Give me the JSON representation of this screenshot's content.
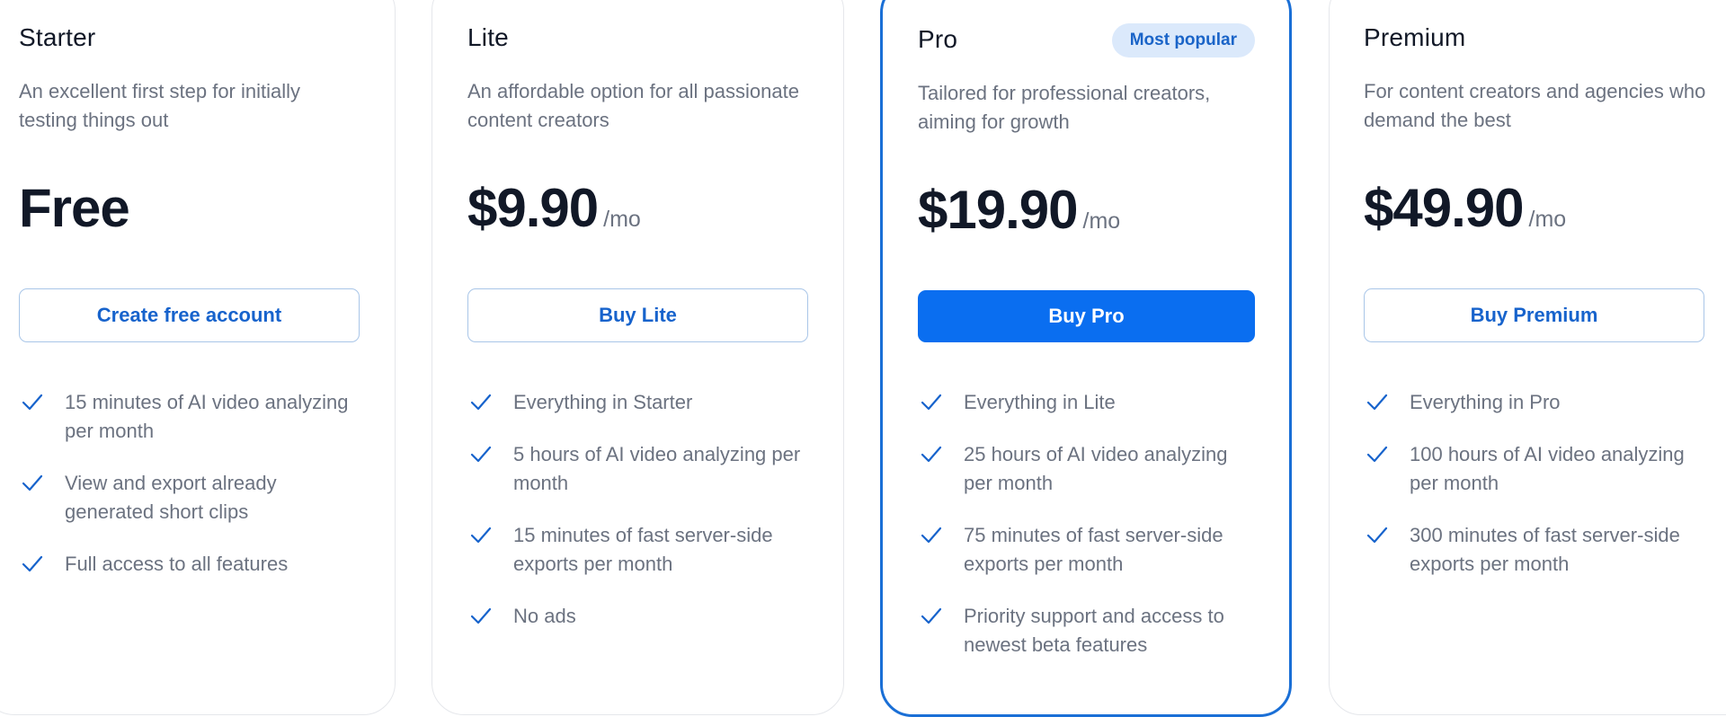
{
  "colors": {
    "accent": "#0a6ef0",
    "featured_border": "#1a6fd6",
    "badge_bg": "#dbe9fb",
    "check": "#1763cc",
    "text_muted": "#6b7280",
    "text_dark": "#111827"
  },
  "plans": [
    {
      "name": "Starter",
      "description": "An excellent first step for initially testing things out",
      "price": "Free",
      "period": "",
      "cta": "Create free account",
      "features": [
        "15 minutes of AI video analyzing per month",
        "View and export already generated short clips",
        "Full access to all features"
      ]
    },
    {
      "name": "Lite",
      "description": "An affordable option for all passionate content creators",
      "price": "$9.90",
      "period": "/mo",
      "cta": "Buy Lite",
      "features": [
        "Everything in Starter",
        "5 hours of AI video analyzing per month",
        "15 minutes of fast server-side exports per month",
        "No ads"
      ]
    },
    {
      "name": "Pro",
      "badge": "Most popular",
      "description": "Tailored for professional creators, aiming for growth",
      "price": "$19.90",
      "period": "/mo",
      "cta": "Buy Pro",
      "features": [
        "Everything in Lite",
        "25 hours of AI video analyzing per month",
        "75 minutes of fast server-side exports per month",
        "Priority support and access to newest beta features"
      ]
    },
    {
      "name": "Premium",
      "description": "For content creators and agencies who demand the best",
      "price": "$49.90",
      "period": "/mo",
      "cta": "Buy Premium",
      "features": [
        "Everything in Pro",
        "100 hours of AI video analyzing per month",
        "300 minutes of fast server-side exports per month"
      ]
    }
  ]
}
